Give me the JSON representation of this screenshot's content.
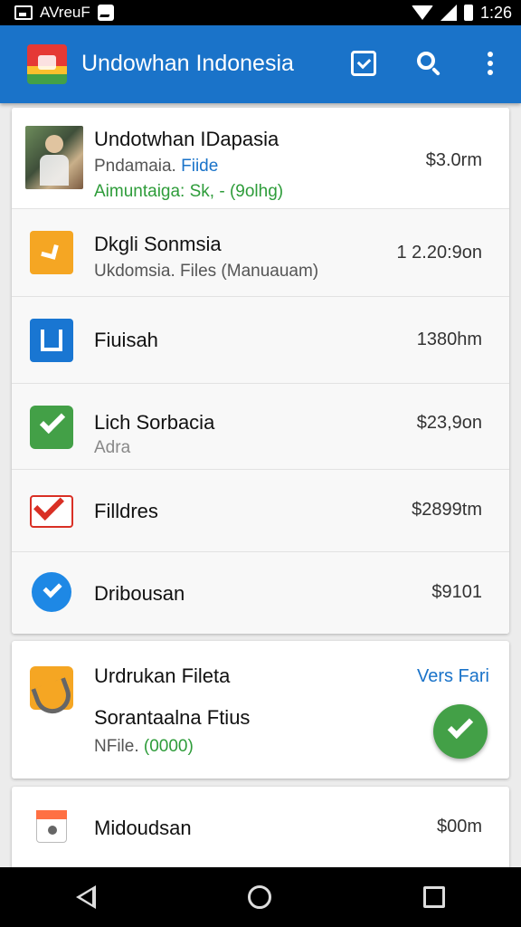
{
  "status_bar": {
    "carrier": "AVreuF",
    "time": "1:26"
  },
  "app_bar": {
    "title": "Undowhan Indonesia"
  },
  "list": [
    {
      "title": "Undotwhan IDapasia",
      "subtitle": "Pndamaia.",
      "subtitle_link": "Fiide",
      "extra": "Aimuntaiga: Sk, - (9olhg)",
      "value": "$3.0rm",
      "icon": "photo-thumbnail"
    },
    {
      "title": "Dkgli Sonmsia",
      "subtitle": "Ukdomsia.  Files (Manuauam)",
      "value": "1 2.20:9on",
      "icon": "orange-app-icon"
    },
    {
      "title": "Fiuisah",
      "subtitle": "",
      "value": "1380hm",
      "icon": "blue-app-icon"
    },
    {
      "title": "Lich Sorbacia",
      "subtitle": "Adra",
      "value": "$23,9on",
      "icon": "green-check-app-icon"
    },
    {
      "title": "Filldres",
      "subtitle": "",
      "value": "$2899tm",
      "icon": "gmail-icon"
    },
    {
      "title": "Dribousan",
      "subtitle": "",
      "value": "$9101",
      "icon": "blue-circle-check-icon"
    }
  ],
  "feature_card": {
    "title": "Urdrukan Fileta",
    "link": "Vers Fari",
    "subtitle": "Sorantaalna Ftius",
    "extra_prefix": "NFile.",
    "extra_value": "(0000)",
    "icon": "tools-icon"
  },
  "bottom_row": {
    "title": "Midoudsan",
    "value": "$00m",
    "icon": "box-icon"
  },
  "colors": {
    "primary": "#1a73c9",
    "accent_green": "#43a047",
    "link_blue": "#1a73c9",
    "green_text": "#2e9c3a"
  }
}
